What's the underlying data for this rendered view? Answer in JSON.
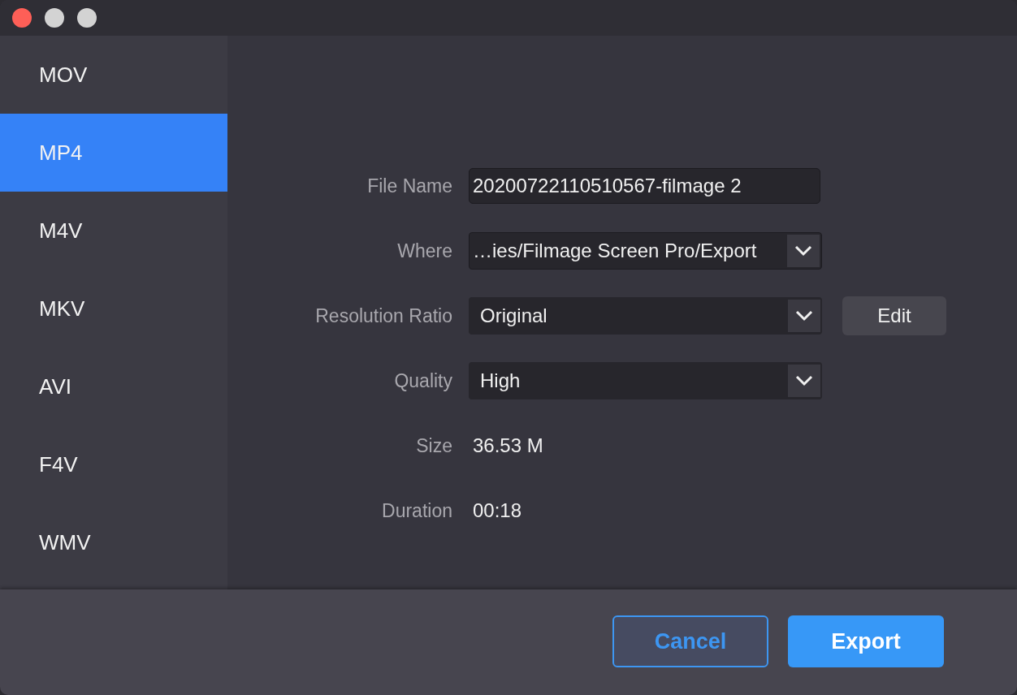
{
  "formats": [
    {
      "label": "MOV",
      "selected": false
    },
    {
      "label": "MP4",
      "selected": true
    },
    {
      "label": "M4V",
      "selected": false
    },
    {
      "label": "MKV",
      "selected": false
    },
    {
      "label": "AVI",
      "selected": false
    },
    {
      "label": "F4V",
      "selected": false
    },
    {
      "label": "WMV",
      "selected": false
    }
  ],
  "fields": [
    {
      "kind": "text",
      "label": "File Name",
      "value": "20200722110510567-filmage 2"
    },
    {
      "kind": "path",
      "label": "Where",
      "value": "…ies/Filmage Screen Pro/Export"
    },
    {
      "kind": "select",
      "label": "Resolution Ratio",
      "value": "Original",
      "button": "Edit"
    },
    {
      "kind": "select",
      "label": "Quality",
      "value": "High"
    },
    {
      "kind": "readout",
      "label": "Size",
      "value": "36.53 M"
    },
    {
      "kind": "readout",
      "label": "Duration",
      "value": "00:18"
    }
  ],
  "buttons": [
    {
      "kind": "secondary",
      "label": "Cancel"
    },
    {
      "kind": "primary",
      "label": "Export"
    }
  ]
}
